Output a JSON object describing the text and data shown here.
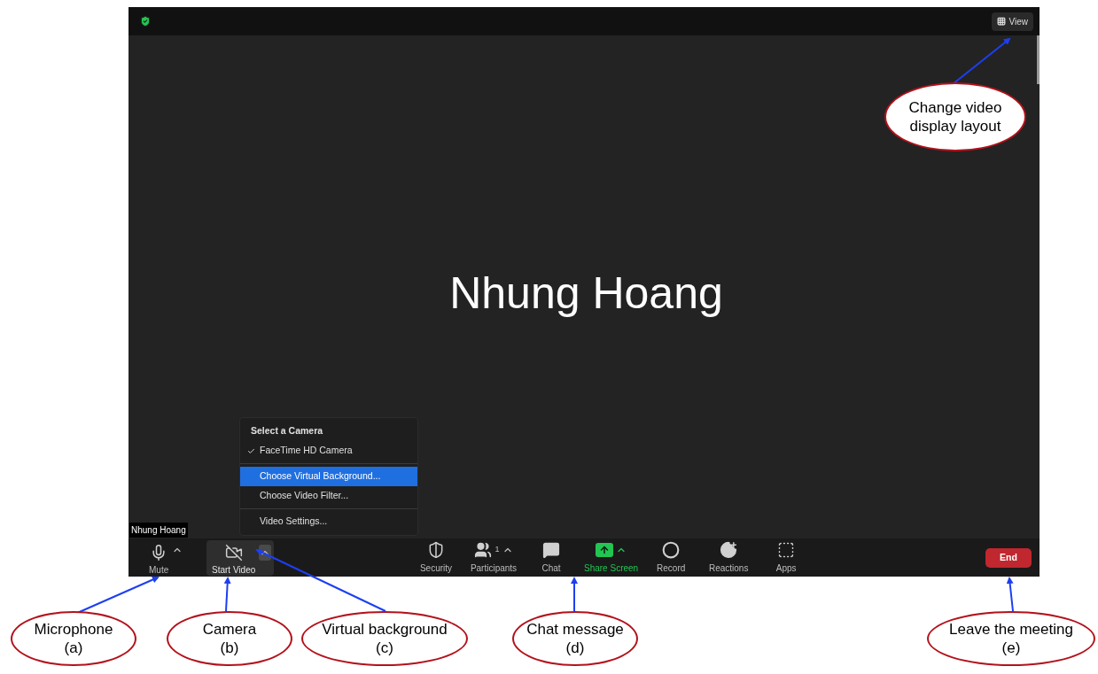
{
  "top_bar": {
    "view_button": "View"
  },
  "participant_name": "Nhung Hoang",
  "name_tag": "Nhung Hoang",
  "camera_menu": {
    "title": "Select a Camera",
    "groups": [
      [
        {
          "label": "FaceTime HD Camera",
          "checked": true,
          "selected": false
        }
      ],
      [
        {
          "label": "Choose Virtual Background...",
          "checked": false,
          "selected": true
        },
        {
          "label": "Choose Video Filter...",
          "checked": false,
          "selected": false
        }
      ],
      [
        {
          "label": "Video Settings...",
          "checked": false,
          "selected": false
        }
      ]
    ]
  },
  "toolbar_left": [
    {
      "label": "Mute",
      "kind": "microphone",
      "has_menu": true,
      "selected": false
    },
    {
      "label": "Start Video",
      "kind": "camera-off",
      "has_menu": true,
      "selected": true
    }
  ],
  "toolbar_center": [
    {
      "label": "Security",
      "kind": "shield",
      "has_menu": false,
      "highlighted": false
    },
    {
      "label": "Participants",
      "kind": "people",
      "has_menu": true,
      "count": "1",
      "highlighted": false
    },
    {
      "label": "Chat",
      "kind": "chat",
      "has_menu": false,
      "highlighted": false
    },
    {
      "label": "Share Screen",
      "kind": "share",
      "has_menu": true,
      "highlighted": true
    },
    {
      "label": "Record",
      "kind": "record",
      "has_menu": false,
      "highlighted": false
    },
    {
      "label": "Reactions",
      "kind": "reactions",
      "has_menu": false,
      "highlighted": false
    },
    {
      "label": "Apps",
      "kind": "apps",
      "has_menu": false,
      "highlighted": false
    }
  ],
  "end_button": "End",
  "annotations": [
    {
      "label": "Microphone",
      "letter": "(a)"
    },
    {
      "label": "Camera",
      "letter": "(b)"
    },
    {
      "label": "Virtual background",
      "letter": "(c)"
    },
    {
      "label": "Chat message",
      "letter": "(d)"
    },
    {
      "label": "Leave the meeting",
      "letter": "(e)"
    },
    {
      "label": "Change video display layout"
    }
  ]
}
